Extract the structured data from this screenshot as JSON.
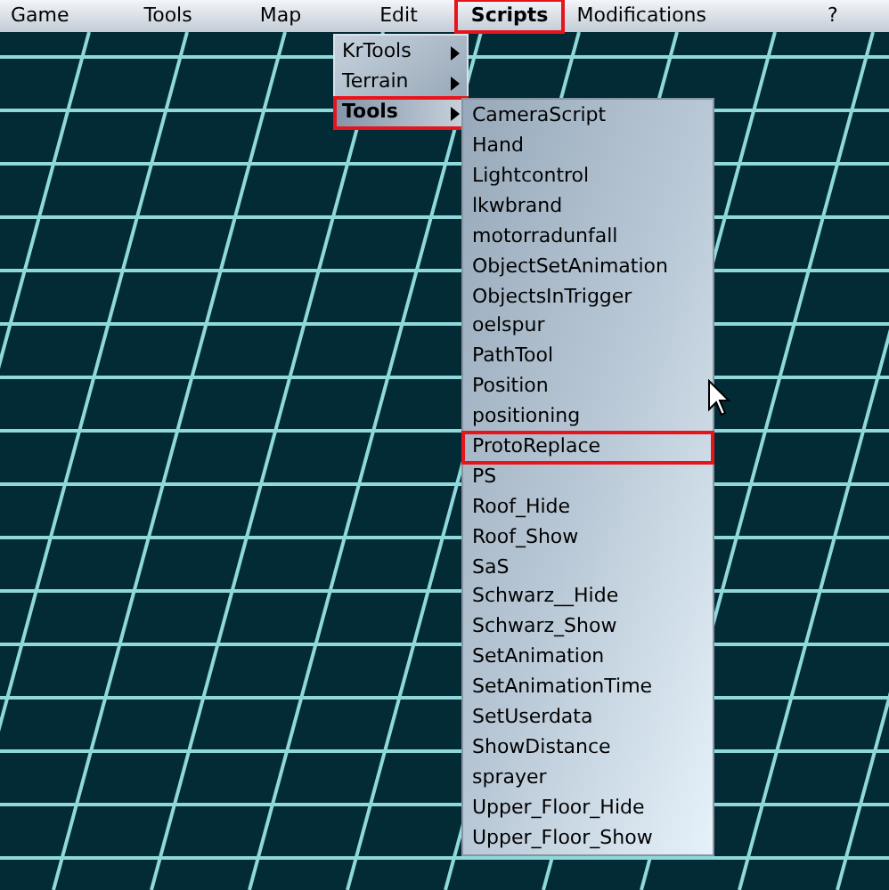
{
  "menu_bar": [
    {
      "label": "Game",
      "highlighted": false
    },
    {
      "label": "Tools",
      "highlighted": false
    },
    {
      "label": "Map",
      "highlighted": false
    },
    {
      "label": "Edit",
      "highlighted": false
    },
    {
      "label": "Scripts",
      "highlighted": true,
      "open": true
    },
    {
      "label": "Modifications",
      "highlighted": false
    },
    {
      "label": "?",
      "highlighted": false
    }
  ],
  "scripts_menu": [
    {
      "label": "KrTools",
      "selected": false,
      "highlighted": false
    },
    {
      "label": "Terrain",
      "selected": false,
      "highlighted": false
    },
    {
      "label": "Tools",
      "selected": true,
      "highlighted": true
    }
  ],
  "tools_submenu": [
    {
      "label": "CameraScript",
      "highlighted": false
    },
    {
      "label": "Hand",
      "highlighted": false
    },
    {
      "label": "Lightcontrol",
      "highlighted": false
    },
    {
      "label": "lkwbrand",
      "highlighted": false
    },
    {
      "label": "motorradunfall",
      "highlighted": false
    },
    {
      "label": "ObjectSetAnimation",
      "highlighted": false
    },
    {
      "label": "ObjectsInTrigger",
      "highlighted": false
    },
    {
      "label": "oelspur",
      "highlighted": false
    },
    {
      "label": "PathTool",
      "highlighted": false
    },
    {
      "label": "Position",
      "highlighted": false
    },
    {
      "label": "positioning",
      "highlighted": false
    },
    {
      "label": "ProtoReplace",
      "highlighted": true
    },
    {
      "label": "PS",
      "highlighted": false
    },
    {
      "label": "Roof_Hide",
      "highlighted": false
    },
    {
      "label": "Roof_Show",
      "highlighted": false
    },
    {
      "label": "SaS",
      "highlighted": false
    },
    {
      "label": "Schwarz__Hide",
      "highlighted": false
    },
    {
      "label": "Schwarz_Show",
      "highlighted": false
    },
    {
      "label": "SetAnimation",
      "highlighted": false
    },
    {
      "label": "SetAnimationTime",
      "highlighted": false
    },
    {
      "label": "SetUserdata",
      "highlighted": false
    },
    {
      "label": "ShowDistance",
      "highlighted": false
    },
    {
      "label": "sprayer",
      "highlighted": false
    },
    {
      "label": "Upper_Floor_Hide",
      "highlighted": false
    },
    {
      "label": "Upper_Floor_Show",
      "highlighted": false
    }
  ]
}
